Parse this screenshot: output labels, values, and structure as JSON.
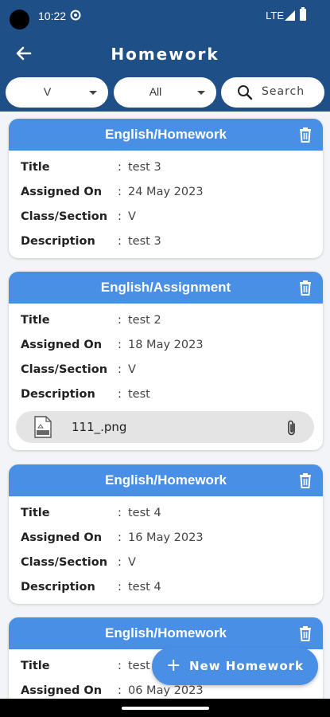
{
  "status": {
    "time": "10:22",
    "network": "LTE"
  },
  "appbar": {
    "title": "Homework"
  },
  "filters": {
    "class_value": "V",
    "section_value": "All",
    "search_label": "Search"
  },
  "labels": {
    "title": "Title",
    "assigned_on": "Assigned On",
    "class_section": "Class/Section",
    "description": "Description",
    "colon": ":"
  },
  "cards": [
    {
      "heading": "English/Homework",
      "title": "test 3",
      "assigned_on": "24 May 2023",
      "class_section": "V",
      "description": "test 3"
    },
    {
      "heading": "English/Assignment",
      "title": "test 2",
      "assigned_on": "18 May 2023",
      "class_section": "V",
      "description": "test",
      "attachment": "111_.png"
    },
    {
      "heading": "English/Homework",
      "title": "test 4",
      "assigned_on": "16 May 2023",
      "class_section": "V",
      "description": "test 4"
    },
    {
      "heading": "English/Homework",
      "title": "test",
      "assigned_on": "06 May 2023"
    }
  ],
  "fab": {
    "label": "New Homework"
  },
  "colors": {
    "primary_dark": "#1e4f86",
    "card_header": "#4a8fe6"
  }
}
